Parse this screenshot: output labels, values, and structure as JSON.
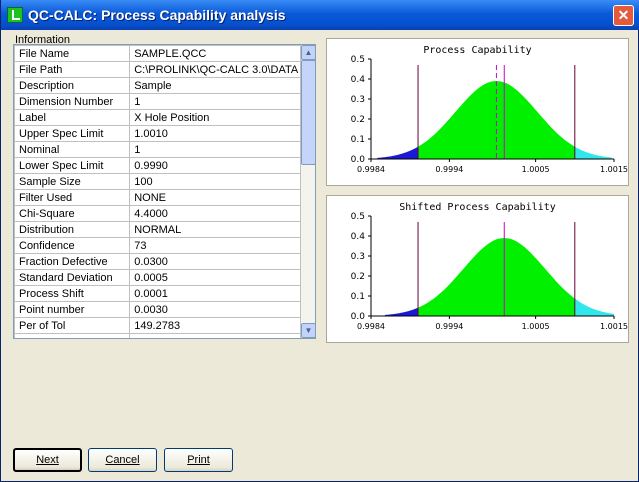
{
  "window": {
    "title": "QC-CALC: Process Capability analysis",
    "close_label": "✕"
  },
  "info": {
    "section_label": "Information",
    "rows": [
      {
        "label": "File Name",
        "value": "SAMPLE.QCC"
      },
      {
        "label": "File Path",
        "value": "C:\\PROLINK\\QC-CALC 3.0\\DATA"
      },
      {
        "label": "Description",
        "value": "Sample"
      },
      {
        "label": "Dimension Number",
        "value": "1"
      },
      {
        "label": "Label",
        "value": "X Hole Position"
      },
      {
        "label": "Upper Spec Limit",
        "value": "1.0010"
      },
      {
        "label": "Nominal",
        "value": "1"
      },
      {
        "label": "Lower Spec Limit",
        "value": "0.9990"
      },
      {
        "label": "Sample Size",
        "value": "100"
      },
      {
        "label": "Filter Used",
        "value": "NONE"
      },
      {
        "label": "Chi-Square",
        "value": "4.4000"
      },
      {
        "label": "Distribution",
        "value": "NORMAL"
      },
      {
        "label": "Confidence",
        "value": "73"
      },
      {
        "label": "Fraction Defective",
        "value": "0.0300"
      },
      {
        "label": "Standard Deviation",
        "value": "0.0005"
      },
      {
        "label": "Process Shift",
        "value": "0.0001"
      },
      {
        "label": "Point number",
        "value": "0.0030"
      },
      {
        "label": "Per of Tol",
        "value": "149.2783"
      },
      {
        "label": "",
        "value": ""
      }
    ],
    "scroll_up_icon": "▲",
    "scroll_down_icon": "▼"
  },
  "buttons": {
    "next": "Next",
    "cancel": "Cancel",
    "print": "Print"
  },
  "chart_data": [
    {
      "type": "area",
      "title": "Process Capability",
      "xlabel": "",
      "ylabel": "",
      "xlim": [
        0.9984,
        1.0015
      ],
      "ylim": [
        0,
        0.5
      ],
      "x_ticks": [
        "0.9984",
        "0.9994",
        "1.0005",
        "1.0015"
      ],
      "x_tick_values": [
        0.9984,
        0.9994,
        1.0005,
        1.0015
      ],
      "y_ticks": [
        "0.0",
        "0.1",
        "0.2",
        "0.3",
        "0.4",
        "0.5"
      ],
      "y_tick_values": [
        0,
        0.1,
        0.2,
        0.3,
        0.4,
        0.5
      ],
      "mean": 1.0,
      "peak": 0.39,
      "sigma": 0.00052,
      "x_start": 0.99848,
      "x_end": 1.00147,
      "lsl": 0.999,
      "usl": 1.001,
      "target_line": 1.0,
      "target_line_dashed": true,
      "mean_line": 1.0001,
      "colors": {
        "left_tail": "#1a1ad6",
        "center": "#00f000",
        "right_tail": "#30e8ec",
        "spec_line": "#660033",
        "mean_line": "#cc00cc"
      }
    },
    {
      "type": "area",
      "title": "Shifted Process Capability",
      "xlabel": "",
      "ylabel": "",
      "xlim": [
        0.9984,
        1.0015
      ],
      "ylim": [
        0,
        0.5
      ],
      "x_ticks": [
        "0.9984",
        "0.9994",
        "1.0005",
        "1.0015"
      ],
      "x_tick_values": [
        0.9984,
        0.9994,
        1.0005,
        1.0015
      ],
      "y_ticks": [
        "0.0",
        "0.1",
        "0.2",
        "0.3",
        "0.4",
        "0.5"
      ],
      "y_tick_values": [
        0,
        0.1,
        0.2,
        0.3,
        0.4,
        0.5
      ],
      "mean": 1.0001,
      "peak": 0.39,
      "sigma": 0.00052,
      "x_start": 0.99858,
      "x_end": 1.0015,
      "lsl": 0.999,
      "usl": 1.001,
      "mean_line": 1.0001,
      "colors": {
        "left_tail": "#1a1ad6",
        "center": "#00f000",
        "right_tail": "#30e8ec",
        "spec_line": "#660033",
        "mean_line": "#cc00cc"
      }
    }
  ]
}
